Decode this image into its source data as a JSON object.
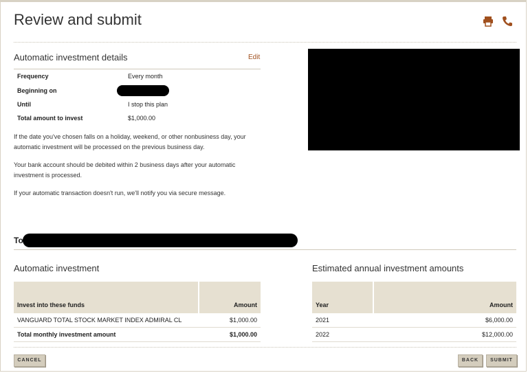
{
  "page": {
    "title": "Review and submit"
  },
  "icons": {
    "print": "printer-icon",
    "phone": "phone-icon",
    "accent_color": "#a0501e"
  },
  "details": {
    "heading": "Automatic investment details",
    "edit_label": "Edit",
    "rows": [
      {
        "label": "Frequency",
        "value": "Every month"
      },
      {
        "label": "Beginning on",
        "value": ""
      },
      {
        "label": "Until",
        "value": "I stop this plan"
      },
      {
        "label": "Total amount to invest",
        "value": "$1,000.00"
      }
    ],
    "notes": [
      "If the date you've chosen falls on a holiday, weekend, or other nonbusiness day, your automatic investment will be processed on the previous business day.",
      "Your bank account should be debited within 2 business days after your automatic investment is processed.",
      "If your automatic transaction doesn't run, we'll notify you via secure message."
    ]
  },
  "to": {
    "label": "To:"
  },
  "investment": {
    "heading": "Automatic investment",
    "columns": [
      "Invest into these funds",
      "Amount"
    ],
    "rows": [
      {
        "fund": "VANGUARD TOTAL STOCK MARKET INDEX ADMIRAL CL",
        "amount": "$1,000.00"
      }
    ],
    "total": {
      "label": "Total monthly investment amount",
      "amount": "$1,000.00"
    }
  },
  "estimates": {
    "heading": "Estimated annual investment amounts",
    "columns": [
      "Year",
      "Amount"
    ],
    "rows": [
      {
        "year": "2021",
        "amount": "$6,000.00"
      },
      {
        "year": "2022",
        "amount": "$12,000.00"
      }
    ]
  },
  "buttons": {
    "cancel": "CANCEL",
    "back": "BACK",
    "submit": "SUBMIT"
  }
}
